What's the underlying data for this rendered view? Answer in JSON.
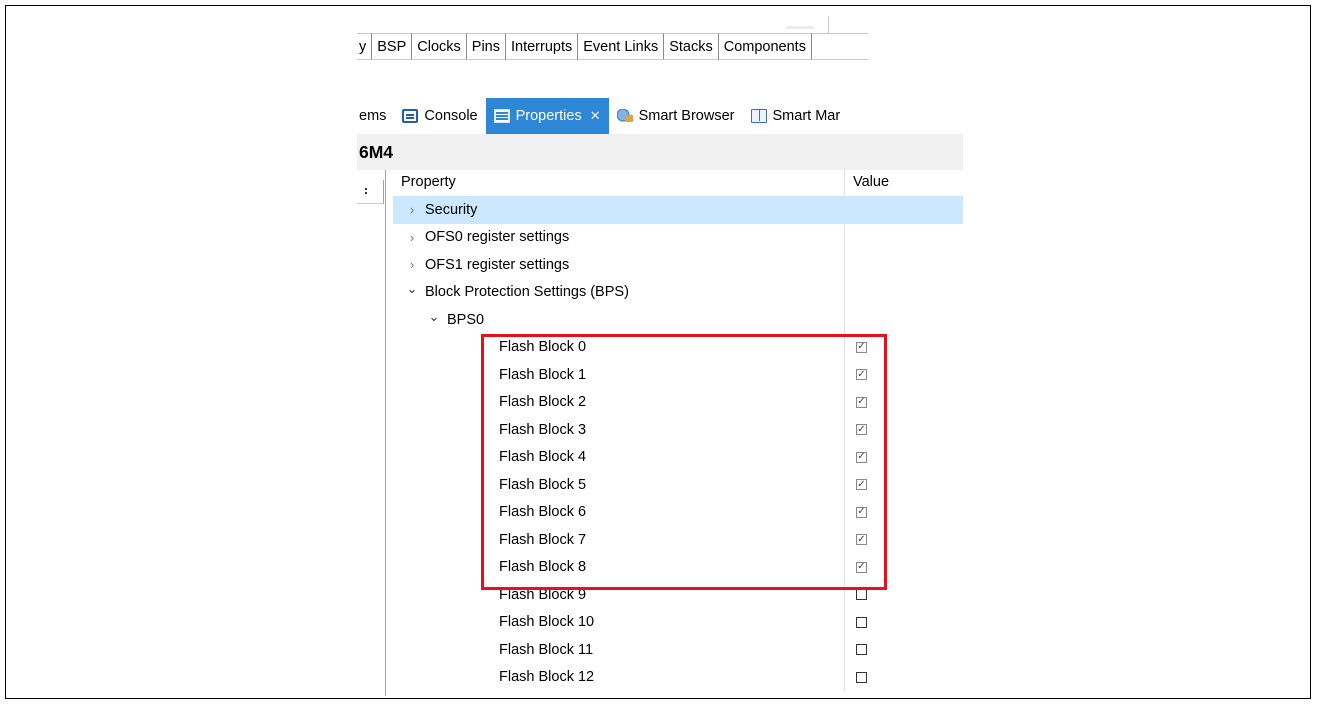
{
  "editor_tabs": [
    "y",
    "BSP",
    "Clocks",
    "Pins",
    "Interrupts",
    "Event Links",
    "Stacks",
    "Components"
  ],
  "view_tabs": [
    {
      "label": "ems",
      "icon": "problems-icon",
      "active": false
    },
    {
      "label": "Console",
      "icon": "console-icon",
      "active": false
    },
    {
      "label": "Properties",
      "icon": "properties-icon",
      "active": true
    },
    {
      "label": "Smart Browser",
      "icon": "smart-browser-icon",
      "active": false
    },
    {
      "label": "Smart Mar",
      "icon": "smart-manual-icon",
      "active": false
    }
  ],
  "properties_title": "6M4",
  "table": {
    "col_property": "Property",
    "col_value": "Value",
    "rows": [
      {
        "label": "Security",
        "level": 1,
        "chevron": "›",
        "selected": true
      },
      {
        "label": "OFS0 register settings",
        "level": 1,
        "chevron": "›"
      },
      {
        "label": "OFS1 register settings",
        "level": 1,
        "chevron": "›"
      },
      {
        "label": "Block Protection Settings (BPS)",
        "level": 1,
        "chevron": "⌄"
      },
      {
        "label": "BPS0",
        "level": 2,
        "chevron": "⌄"
      },
      {
        "label": "Flash Block 0",
        "level": 3,
        "checked": true
      },
      {
        "label": "Flash Block 1",
        "level": 3,
        "checked": true
      },
      {
        "label": "Flash Block 2",
        "level": 3,
        "checked": true
      },
      {
        "label": "Flash Block 3",
        "level": 3,
        "checked": true
      },
      {
        "label": "Flash Block 4",
        "level": 3,
        "checked": true
      },
      {
        "label": "Flash Block 5",
        "level": 3,
        "checked": true
      },
      {
        "label": "Flash Block 6",
        "level": 3,
        "checked": true
      },
      {
        "label": "Flash Block 7",
        "level": 3,
        "checked": true
      },
      {
        "label": "Flash Block 8",
        "level": 3,
        "checked": true
      },
      {
        "label": "Flash Block 9",
        "level": 3,
        "checked": false
      },
      {
        "label": "Flash Block 10",
        "level": 3,
        "checked": false
      },
      {
        "label": "Flash Block 11",
        "level": 3,
        "checked": false
      },
      {
        "label": "Flash Block 12",
        "level": 3,
        "checked": false
      }
    ]
  },
  "colors": {
    "active_tab": "#2e86d6",
    "selected_row": "#cce8ff",
    "highlight_box": "#e8101b"
  }
}
